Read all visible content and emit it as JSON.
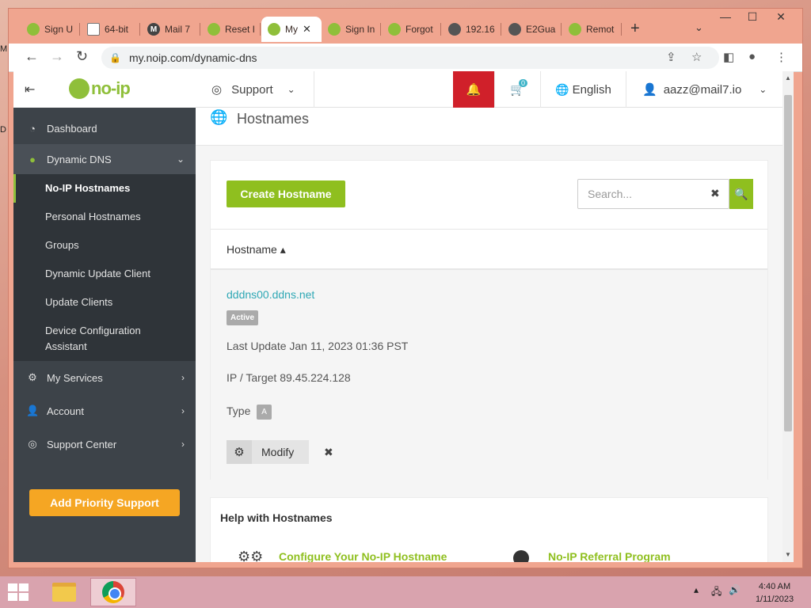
{
  "browser": {
    "tabs": [
      {
        "label": "Sign U",
        "icon": "noip-favicon"
      },
      {
        "label": "64-bit",
        "icon": "document-favicon"
      },
      {
        "label": "Mail 7",
        "icon": "mail7-favicon"
      },
      {
        "label": "Reset I",
        "icon": "noip-favicon"
      },
      {
        "label": "My",
        "icon": "noip-favicon",
        "active": true
      },
      {
        "label": "Sign In",
        "icon": "noip-favicon"
      },
      {
        "label": "Forgot",
        "icon": "noip-favicon"
      },
      {
        "label": "192.16",
        "icon": "globe-favicon"
      },
      {
        "label": "E2Gua",
        "icon": "globe-favicon"
      },
      {
        "label": "Remot",
        "icon": "noip-favicon"
      }
    ],
    "new_tab": "+",
    "url": "my.noip.com/dynamic-dns"
  },
  "header": {
    "logo_text": "no-ip",
    "support_label": "Support",
    "cart_count": "0",
    "language": "English",
    "user_email": "aazz@mail7.io"
  },
  "sidebar": {
    "items": [
      {
        "label": "Dashboard",
        "icon": "dashboard-icon"
      },
      {
        "label": "Dynamic DNS",
        "icon": "globe-icon"
      },
      {
        "label": "My Services",
        "icon": "gear-icon"
      },
      {
        "label": "Account",
        "icon": "user-icon"
      },
      {
        "label": "Support Center",
        "icon": "lifebuoy-icon"
      }
    ],
    "dns_sub": [
      {
        "label": "No-IP Hostnames",
        "current": true
      },
      {
        "label": "Personal Hostnames"
      },
      {
        "label": "Groups"
      },
      {
        "label": "Dynamic Update Client"
      },
      {
        "label": "Update Clients"
      },
      {
        "label": "Device Configuration"
      },
      {
        "label": "Assistant"
      }
    ],
    "priority_button": "Add Priority Support"
  },
  "page": {
    "title": "Hostnames",
    "create_button": "Create Hostname",
    "search_placeholder": "Search...",
    "column_header": "Hostname ▴",
    "hostname": {
      "name": "dddns00.ddns.net",
      "status": "Active",
      "last_update": "Last Update Jan 11, 2023 01:36 PST",
      "ip_target": "IP / Target 89.45.224.128",
      "type_label": "Type",
      "type_value": "A",
      "modify_label": "Modify"
    },
    "help": {
      "title": "Help with Hostnames",
      "link1": "Configure Your No-IP Hostname",
      "link2": "No-IP Referral Program"
    }
  },
  "taskbar": {
    "time": "4:40 AM",
    "date": "1/11/2023"
  },
  "colors": {
    "accent_green": "#8fbf1f",
    "link_teal": "#2fa8b5",
    "sidebar_dark": "#3d4349",
    "bell_red": "#d0202a",
    "priority_orange": "#f5a623"
  }
}
